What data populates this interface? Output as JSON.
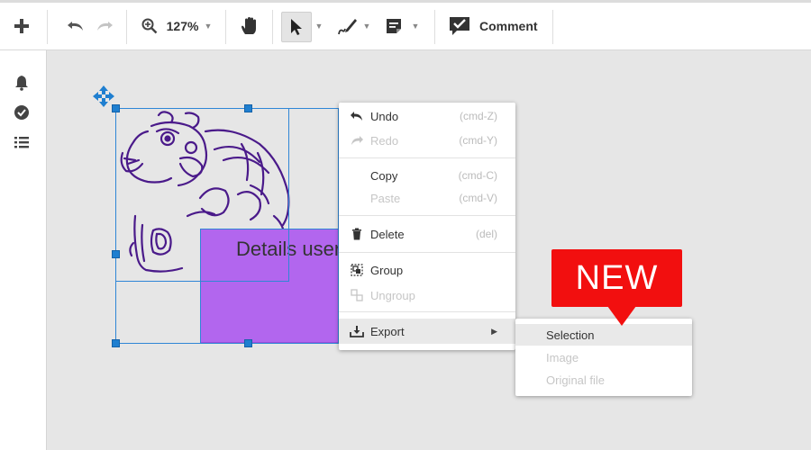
{
  "toolbar": {
    "add_icon": "plus-icon",
    "undo_icon": "undo-icon",
    "redo_icon": "redo-icon",
    "zoom_icon": "zoom-in-icon",
    "zoom_level": "127%",
    "hand_icon": "hand-icon",
    "select_icon": "pointer-icon",
    "pen_icon": "pen-icon",
    "note_icon": "note-icon",
    "comment_label": "Comment"
  },
  "rail": {
    "icons": [
      "bell-icon",
      "check-circle-icon",
      "list-icon"
    ]
  },
  "canvas": {
    "sticky_note_text": "Details user story",
    "sticky_color": "#b266ee",
    "selection_color": "#2f86d6"
  },
  "context_menu": {
    "items": [
      {
        "label": "Undo",
        "shortcut": "(cmd-Z)",
        "icon": "undo-icon",
        "enabled": true
      },
      {
        "label": "Redo",
        "shortcut": "(cmd-Y)",
        "icon": "redo-icon",
        "enabled": false
      },
      {
        "label": "Copy",
        "shortcut": "(cmd-C)",
        "icon": "",
        "enabled": true
      },
      {
        "label": "Paste",
        "shortcut": "(cmd-V)",
        "icon": "",
        "enabled": false
      },
      {
        "label": "Delete",
        "shortcut": "(del)",
        "icon": "trash-icon",
        "enabled": true
      },
      {
        "label": "Group",
        "shortcut": "",
        "icon": "group-icon",
        "enabled": true
      },
      {
        "label": "Ungroup",
        "shortcut": "",
        "icon": "ungroup-icon",
        "enabled": false
      },
      {
        "label": "Export",
        "shortcut": "",
        "icon": "download-icon",
        "enabled": true,
        "submenu": true
      }
    ]
  },
  "export_submenu": {
    "items": [
      {
        "label": "Selection",
        "enabled": true,
        "highlighted": true
      },
      {
        "label": "Image",
        "enabled": false
      },
      {
        "label": "Original file",
        "enabled": false
      }
    ]
  },
  "badge": {
    "text": "NEW",
    "color": "#f20f0f"
  }
}
